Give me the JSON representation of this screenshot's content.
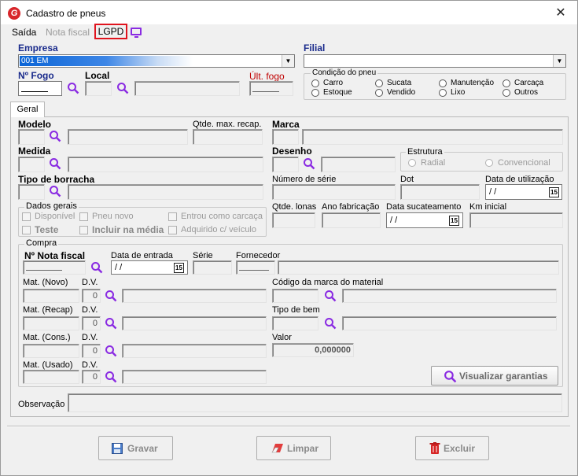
{
  "window": {
    "title": "Cadastro de pneus",
    "close_symbol": "✕"
  },
  "menu": {
    "saida": "Saída",
    "nota_fiscal": "Nota fiscal",
    "lgpd": "LGPD"
  },
  "top": {
    "empresa_label": "Empresa",
    "empresa_value": "001 EM",
    "filial_label": "Filial",
    "num_fogo_label": "Nº Fogo",
    "local_label": "Local",
    "ult_fogo_label": "Últ. fogo",
    "condicao_title": "Condição do pneu",
    "condicao_options": [
      "Carro",
      "Sucata",
      "Manutenção",
      "Carcaça",
      "Estoque",
      "Vendido",
      "Lixo",
      "Outros"
    ]
  },
  "tabs": {
    "geral": "Geral"
  },
  "geral": {
    "modelo": "Modelo",
    "qtde_max_recap": "Qtde. max. recap.",
    "marca": "Marca",
    "medida": "Medida",
    "desenho": "Desenho",
    "estrutura_title": "Estrutura",
    "estrutura_radial": "Radial",
    "estrutura_convencional": "Convencional",
    "tipo_borracha": "Tipo de borracha",
    "numero_serie": "Número de série",
    "dot": "Dot",
    "data_utilizacao": "Data de utilização",
    "date_placeholder": " / /",
    "calendar_day": "15",
    "dados_gerais_title": "Dados gerais",
    "disponivel": "Disponível",
    "pneu_novo": "Pneu novo",
    "entrou_como_carcaca": "Entrou como carcaça",
    "teste": "Teste",
    "incluir_na_media": "Incluir na média",
    "adquirido_c_veiculo": "Adquirido c/ veículo",
    "qtde_lonas": "Qtde. lonas",
    "ano_fabricacao": "Ano fabricação",
    "data_sucateamento": "Data sucateamento",
    "km_inicial": "Km inicial"
  },
  "compra": {
    "title": "Compra",
    "nota_fiscal": "Nº Nota fiscal",
    "data_entrada": "Data de entrada",
    "serie": "Série",
    "fornecedor": "Fornecedor",
    "mat_novo": "Mat. (Novo)",
    "mat_recap": "Mat. (Recap)",
    "mat_cons": "Mat. (Cons.)",
    "mat_usado": "Mat. (Usado)",
    "dv": "D.V.",
    "dv_value": "0",
    "codigo_marca_material": "Código da marca do material",
    "tipo_de_bem": "Tipo de bem",
    "valor": "Valor",
    "valor_value": "0,000000",
    "visualizar_garantias": "Visualizar garantias"
  },
  "observacao": "Observação",
  "buttons": {
    "gravar": "Gravar",
    "limpar": "Limpar",
    "excluir": "Excluir"
  },
  "colors": {
    "accent": "#0a64d6",
    "icon_purple": "#8a2be2",
    "highlight_red": "#e0141e",
    "label_red": "#c00000"
  },
  "icons": [
    "search-icon",
    "calendar-icon",
    "save-icon",
    "eraser-icon",
    "trash-icon",
    "monitor-icon",
    "close-icon",
    "dropdown-arrow-icon"
  ]
}
